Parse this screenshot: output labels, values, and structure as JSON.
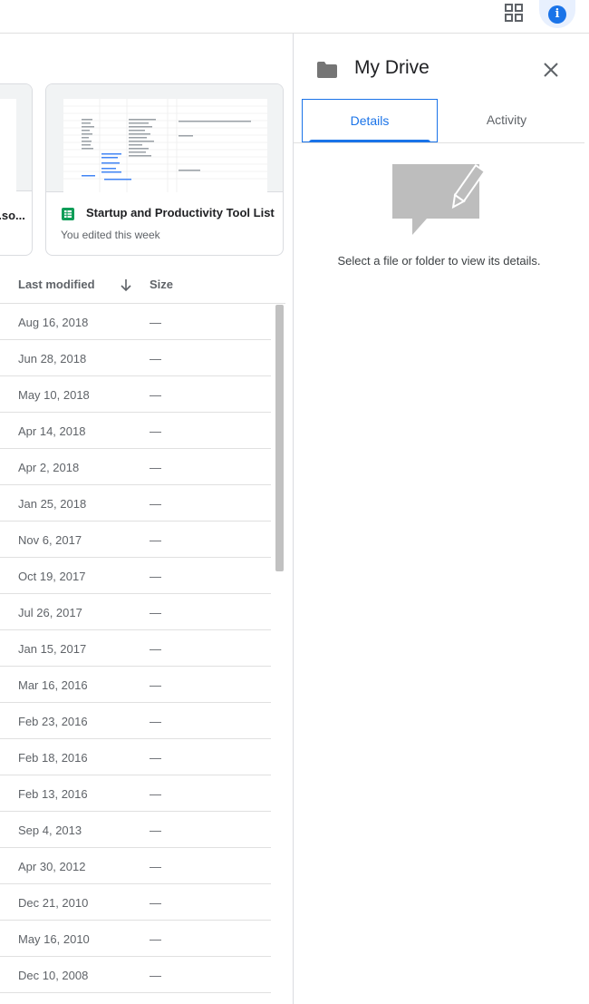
{
  "topbar": {
    "grid_icon": "apps-grid-icon",
    "info_icon": "info-icon",
    "info_glyph": "i",
    "accent": "#1a73e8"
  },
  "cards": [
    {
      "title": "...so...",
      "partial": true
    },
    {
      "title": "Startup and Productivity Tool List",
      "subtitle": "You edited this week",
      "icon": "sheets-icon",
      "icon_color": "#0f9d58"
    }
  ],
  "list": {
    "headers": {
      "modified": "Last modified",
      "size": "Size"
    },
    "sort_icon": "arrow-down-icon",
    "rows": [
      {
        "date": "Aug 16, 2018",
        "size": "—"
      },
      {
        "date": "Jun 28, 2018",
        "size": "—"
      },
      {
        "date": "May 10, 2018",
        "size": "—"
      },
      {
        "date": "Apr 14, 2018",
        "size": "—"
      },
      {
        "date": "Apr 2, 2018",
        "size": "—"
      },
      {
        "date": "Jan 25, 2018",
        "size": "—"
      },
      {
        "date": "Nov 6, 2017",
        "size": "—"
      },
      {
        "date": "Oct 19, 2017",
        "size": "—"
      },
      {
        "date": "Jul 26, 2017",
        "size": "—"
      },
      {
        "date": "Jan 15, 2017",
        "size": "—"
      },
      {
        "date": "Mar 16, 2016",
        "size": "—"
      },
      {
        "date": "Feb 23, 2016",
        "size": "—"
      },
      {
        "date": "Feb 18, 2016",
        "size": "—"
      },
      {
        "date": "Feb 13, 2016",
        "size": "—"
      },
      {
        "date": "Sep 4, 2013",
        "size": "—"
      },
      {
        "date": "Apr 30, 2012",
        "size": "—"
      },
      {
        "date": "Dec 21, 2010",
        "size": "—"
      },
      {
        "date": "May 16, 2010",
        "size": "—"
      },
      {
        "date": "Dec 10, 2008",
        "size": "—"
      }
    ]
  },
  "panel": {
    "title": "My Drive",
    "folder_icon": "folder-icon",
    "close_icon": "close-icon",
    "tabs": [
      {
        "label": "Details",
        "active": true
      },
      {
        "label": "Activity",
        "active": false
      }
    ],
    "empty_message": "Select a file or folder to view its details."
  }
}
